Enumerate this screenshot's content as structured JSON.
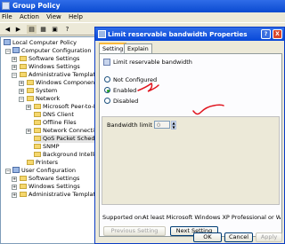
{
  "window": {
    "title": "Group Policy",
    "menu": [
      "File",
      "Action",
      "View",
      "Help"
    ]
  },
  "tree": {
    "root": "Local Computer Policy",
    "computer_configuration": "Computer Configuration",
    "software_settings": "Software Settings",
    "windows_settings": "Windows Settings",
    "administrative_templates": "Administrative Templates",
    "windows_components": "Windows Components",
    "system": "System",
    "network": "Network",
    "ms_peer": "Microsoft Peer-to-P",
    "dns_client": "DNS Client",
    "offline_files": "Offline Files",
    "network_connections": "Network Connectio",
    "qos": "QoS Packet Schedu",
    "snmp": "SNMP",
    "bits": "Background Intellig",
    "printers": "Printers",
    "user_configuration": "User Configuration",
    "user_software_settings": "Software Settings",
    "user_windows_settings": "Windows Settings",
    "user_administrative_templates": "Administrative Templates"
  },
  "dialog": {
    "title": "Limit reservable bandwidth Properties",
    "help_button": "?",
    "close_button": "X",
    "tabs": [
      "Setting",
      "Explain"
    ],
    "setting_name": "Limit reservable bandwidth",
    "options": [
      "Not Configured",
      "Enabled",
      "Disabled"
    ],
    "selected_option": "Enabled",
    "bandwidth_label": "Bandwidth limit (%):",
    "bandwidth_value": "0",
    "supported_on_label": "Supported on:",
    "supported_on_value": "At least Microsoft Windows XP Professional or Windo...",
    "previous_setting": "Previous Setting",
    "next_setting": "Next Setting",
    "ok": "OK",
    "cancel": "Cancel",
    "apply": "Apply"
  },
  "colors": {
    "titlebar": "#0a4ad0",
    "annotation": "#e0141e",
    "radio_checked": "#21a121"
  }
}
